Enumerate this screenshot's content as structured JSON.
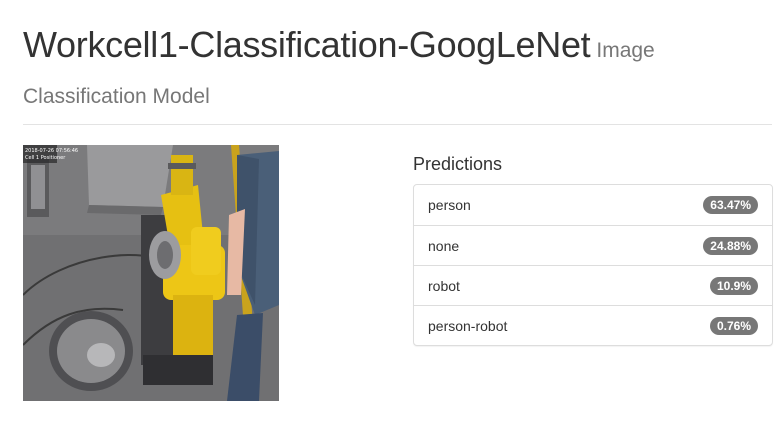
{
  "header": {
    "title": "Workcell1-Classification-GoogLeNet",
    "title_suffix": "Image",
    "subtitle": "Classification Model"
  },
  "image": {
    "overlay_text_line1": "2018-07-26 07:56:46",
    "overlay_text_line2": "Cell 1 Positioner"
  },
  "predictions": {
    "heading": "Predictions",
    "items": [
      {
        "label": "person",
        "value": "63.47%"
      },
      {
        "label": "none",
        "value": "24.88%"
      },
      {
        "label": "robot",
        "value": "10.9%"
      },
      {
        "label": "person-robot",
        "value": "0.76%"
      }
    ],
    "badge_color": "#777777"
  }
}
